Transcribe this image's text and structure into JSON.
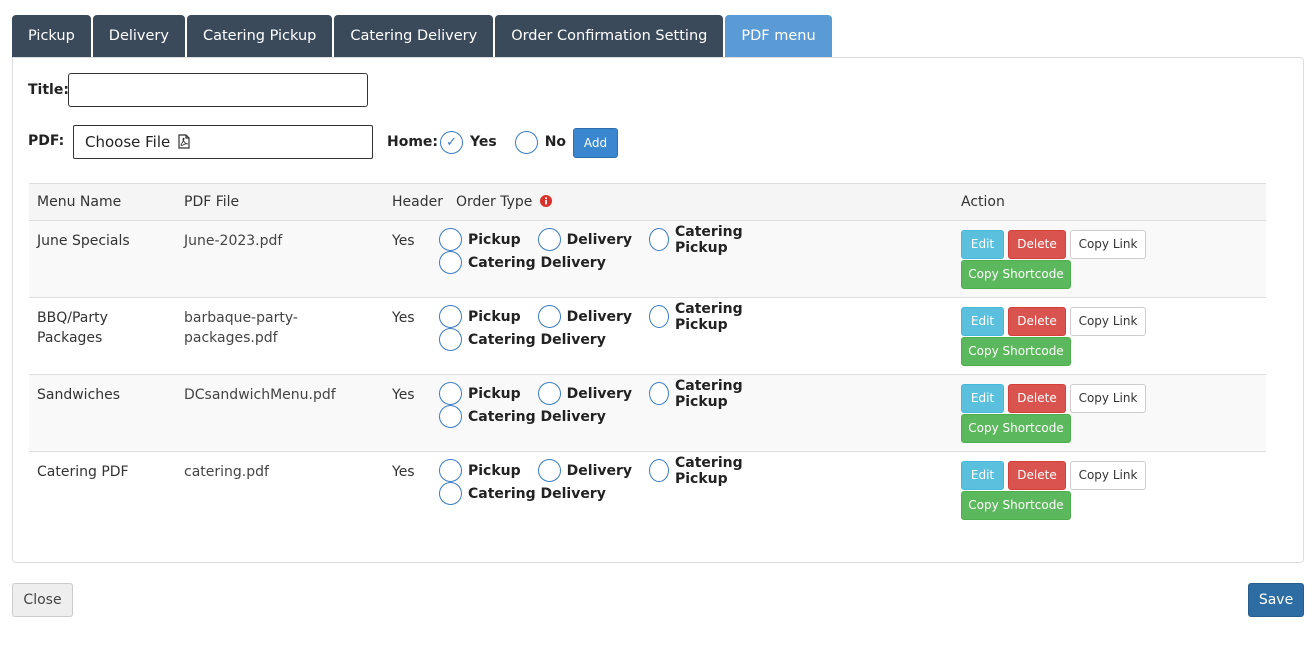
{
  "tabs": [
    {
      "label": "Pickup",
      "active": false
    },
    {
      "label": "Delivery",
      "active": false
    },
    {
      "label": "Catering Pickup",
      "active": false
    },
    {
      "label": "Catering Delivery",
      "active": false
    },
    {
      "label": "Order Confirmation Setting",
      "active": false
    },
    {
      "label": "PDF menu",
      "active": true
    }
  ],
  "form": {
    "title_label": "Title:",
    "title_value": "",
    "pdf_label": "PDF:",
    "file_button_label": "Choose File",
    "home_label": "Home:",
    "home_options": [
      {
        "label": "Yes",
        "checked": true
      },
      {
        "label": "No",
        "checked": false
      }
    ],
    "add_label": "Add"
  },
  "table": {
    "headers": {
      "menu_name": "Menu Name",
      "pdf_file": "PDF File",
      "header": "Header",
      "order_type": "Order Type",
      "action": "Action"
    },
    "order_type_options": [
      "Pickup",
      "Delivery",
      "Catering Pickup",
      "Catering Delivery"
    ],
    "action_labels": {
      "edit": "Edit",
      "delete": "Delete",
      "copy_link": "Copy Link",
      "copy_shortcode": "Copy Shortcode"
    },
    "rows": [
      {
        "menu_name": "June Specials",
        "pdf_file": "June-2023.pdf",
        "header": "Yes"
      },
      {
        "menu_name": "BBQ/Party\nPackages",
        "pdf_file": "barbaque-party-\npackages.pdf",
        "header": "Yes"
      },
      {
        "menu_name": "Sandwiches",
        "pdf_file": "DCsandwichMenu.pdf",
        "header": "Yes"
      },
      {
        "menu_name": "Catering PDF",
        "pdf_file": "catering.pdf",
        "header": "Yes"
      }
    ]
  },
  "footer": {
    "close_label": "Close",
    "save_label": "Save"
  },
  "colors": {
    "tab_bg": "#3b4a5b",
    "tab_active_bg": "#5b9bd5",
    "radio_border": "#3a7cc3",
    "edit": "#5bc0de",
    "delete": "#d9534f",
    "shortcode": "#5cb85c",
    "save": "#2e6da4",
    "info_icon": "#d9302c"
  },
  "icons": {
    "file": "pdf-file-icon",
    "info": "info-circle-icon",
    "check": "check-icon"
  }
}
